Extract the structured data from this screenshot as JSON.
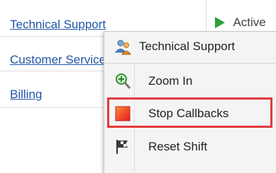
{
  "table": {
    "rows": [
      {
        "name": "Technical Support"
      },
      {
        "name": "Customer Service"
      },
      {
        "name": "Billing"
      }
    ],
    "status_partial": "Active"
  },
  "context_menu": {
    "header": {
      "label": "Technical Support",
      "icon": "people-icon"
    },
    "items": [
      {
        "label": "Zoom In",
        "icon": "magnifier-plus-icon"
      },
      {
        "label": "Stop Callbacks",
        "icon": "stop-square-icon",
        "highlighted": true
      },
      {
        "label": "Reset Shift",
        "icon": "flag-icon"
      }
    ]
  },
  "colors": {
    "link": "#1f56a6",
    "highlight_border": "#e23b3b",
    "status_green": "#2e9e3a"
  }
}
